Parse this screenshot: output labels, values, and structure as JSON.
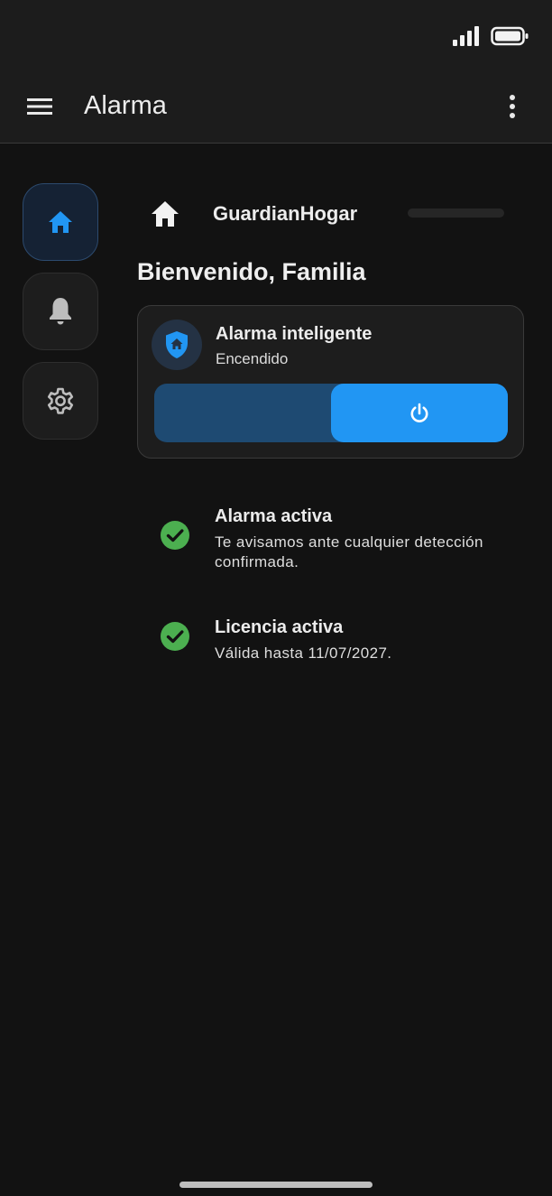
{
  "app_bar": {
    "title": "Alarma"
  },
  "rail": {
    "items": [
      {
        "icon": "home-icon",
        "active": true
      },
      {
        "icon": "bell-icon",
        "active": false
      },
      {
        "icon": "gear-icon",
        "active": false
      }
    ]
  },
  "brand": {
    "name": "GuardianHogar",
    "icon": "home-icon"
  },
  "welcome": "Bienvenido, Familia",
  "alarm_card": {
    "title": "Alarma inteligente",
    "status": "Encendido",
    "icon": "shield-home-icon",
    "toggle_on": true
  },
  "status_items": [
    {
      "title": "Alarma activa",
      "description": "Te avisamos ante cualquier detección confirmada.",
      "icon": "check-circle-icon"
    },
    {
      "title": "Licencia activa",
      "description": "Válida hasta 11/07/2027.",
      "icon": "check-circle-icon"
    }
  ],
  "colors": {
    "accent": "#2196f3",
    "accent_dark": "#1e4a72",
    "success": "#4caf50",
    "background": "#121212",
    "surface": "#1d1d1d"
  }
}
